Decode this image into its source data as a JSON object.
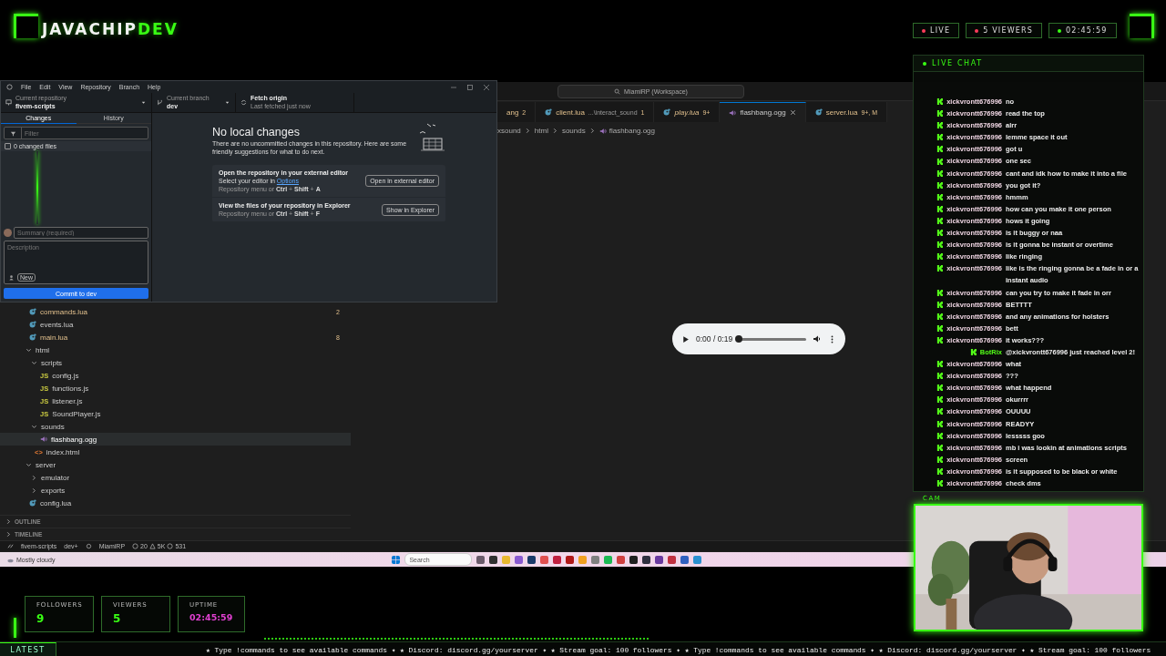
{
  "overlay": {
    "brand": {
      "name": "JAVACHIP",
      "accent": "DEV"
    },
    "badges": [
      {
        "label": "LIVE",
        "color": "#ff3b5c"
      },
      {
        "label": "5 VIEWERS",
        "color": "#ff3b5c"
      },
      {
        "label": "02:45:59",
        "color": "#39ff14"
      }
    ]
  },
  "github_desktop": {
    "menu": [
      "File",
      "Edit",
      "View",
      "Repository",
      "Branch",
      "Help"
    ],
    "repository": {
      "caption": "Current repository",
      "value": "fivem-scripts"
    },
    "branch": {
      "caption": "Current branch",
      "value": "dev"
    },
    "fetch": {
      "caption": "Fetch origin",
      "detail": "Last fetched just now"
    },
    "tabs": [
      {
        "label": "Changes",
        "selected": true
      },
      {
        "label": "History",
        "selected": false
      }
    ],
    "filter": {
      "placeholder": "Filter"
    },
    "select_all": {
      "checked": false,
      "label": "0 changed files"
    },
    "summary": {
      "placeholder": "Summary (required)"
    },
    "description": {
      "placeholder": "Description"
    },
    "coauthor_badge": "New",
    "commit_button": "Commit to dev",
    "heading": "No local changes",
    "intro": "There are no uncommitted changes in this repository. Here are some friendly suggestions for what to do next.",
    "suggestions": [
      {
        "title": "Open the repository in your external editor",
        "line": "Select your editor in",
        "link": "Options",
        "hint": "Repository menu or **Ctrl** + **Shift** + **A**",
        "button": "Open in external editor"
      },
      {
        "title": "View the files of your repository in Explorer",
        "hint": "Repository menu or **Ctrl** + **Shift** + **F**",
        "button": "Show in Explorer"
      }
    ]
  },
  "vscode": {
    "search": "MiamiRP (Workspace)",
    "tabs": [
      {
        "label": "ang",
        "badge": "2",
        "modified": true,
        "preview": false,
        "selected": false
      },
      {
        "label": "client.lua",
        "detail": "...\\interact_sound",
        "badge": "1",
        "kind": "lua",
        "modified": true,
        "preview": false,
        "selected": false
      },
      {
        "label": "play.lua",
        "badge": "9+",
        "kind": "lua",
        "modified": true,
        "preview": true,
        "selected": false
      },
      {
        "label": "flashbang.ogg",
        "kind": "audio",
        "modified": false,
        "preview": false,
        "selected": true
      },
      {
        "label": "server.lua",
        "badge": "9+, M",
        "kind": "lua",
        "modified": true,
        "preview": false,
        "selected": false
      }
    ],
    "breadcrumb": [
      "xsound",
      "html",
      "sounds",
      "flashbang.ogg"
    ],
    "explorer": [
      {
        "name": "commands.lua",
        "kind": "lua",
        "modified": true,
        "badge": "2",
        "selected": false
      },
      {
        "name": "events.lua",
        "kind": "lua",
        "modified": false,
        "selected": false
      },
      {
        "name": "main.lua",
        "kind": "lua",
        "modified": true,
        "badge": "8",
        "selected": false
      },
      {
        "name": "html",
        "kind": "folder",
        "expanded": true,
        "selected": false,
        "children": [
          {
            "name": "scripts",
            "kind": "folder",
            "expanded": true,
            "selected": false,
            "children": [
              {
                "name": "config.js",
                "kind": "js",
                "icon_text": "JS",
                "modified": false,
                "selected": false
              },
              {
                "name": "functions.js",
                "kind": "js",
                "icon_text": "JS",
                "modified": false,
                "selected": false
              },
              {
                "name": "listener.js",
                "kind": "js",
                "icon_text": "JS",
                "modified": false,
                "selected": false
              },
              {
                "name": "SoundPlayer.js",
                "kind": "js",
                "icon_text": "JS",
                "modified": false,
                "selected": false
              }
            ]
          },
          {
            "name": "sounds",
            "kind": "folder",
            "expanded": true,
            "selected": false,
            "children": [
              {
                "name": "flashbang.ogg",
                "kind": "audio",
                "modified": false,
                "selected": true
              }
            ]
          },
          {
            "name": "index.html",
            "kind": "html",
            "icon_text": "<>",
            "modified": false,
            "selected": false
          }
        ]
      },
      {
        "name": "server",
        "kind": "folder",
        "expanded": true,
        "selected": false,
        "children": [
          {
            "name": "emulator",
            "kind": "folder",
            "expanded": false,
            "selected": false
          },
          {
            "name": "exports",
            "kind": "folder",
            "expanded": false,
            "selected": false
          }
        ]
      },
      {
        "name": "config.lua",
        "kind": "lua",
        "modified": false,
        "selected": false
      }
    ],
    "sections": [
      {
        "label": "OUTLINE",
        "expanded": false
      },
      {
        "label": "TIMELINE",
        "expanded": false
      }
    ],
    "audio": {
      "time": "0:00 / 0:19",
      "level": 0
    },
    "status_bar": {
      "workspace": "fivem-scripts",
      "branch": "dev+",
      "project": "MiamiRP",
      "errors": "20",
      "warnings": "5K",
      "infos": "531"
    }
  },
  "taskbar": {
    "weather": "Mostly cloudy",
    "search_placeholder": "Search",
    "apps": [
      {
        "color": "#6a5a6a"
      },
      {
        "color": "#303030"
      },
      {
        "color": "#e8b830"
      },
      {
        "color": "#8a5ad0"
      },
      {
        "color": "#1a3a6a"
      },
      {
        "color": "#e05050"
      },
      {
        "color": "#c02040"
      },
      {
        "color": "#b01818"
      },
      {
        "color": "#f0a020"
      },
      {
        "color": "#808080"
      },
      {
        "color": "#1db954"
      },
      {
        "color": "#d04040"
      },
      {
        "color": "#202020"
      },
      {
        "color": "#303040"
      },
      {
        "color": "#6a3aa0"
      },
      {
        "color": "#c03040"
      },
      {
        "color": "#3060c0"
      },
      {
        "color": "#2a90d0"
      }
    ]
  },
  "chat": {
    "title": "LIVE CHAT",
    "messages": [
      {
        "kind": "viewer",
        "user": "xickvrontt676996",
        "text": "no"
      },
      {
        "kind": "viewer",
        "user": "xickvrontt676996",
        "text": "read the top"
      },
      {
        "kind": "viewer",
        "user": "xickvrontt676996",
        "text": "alrr"
      },
      {
        "kind": "viewer",
        "user": "xickvrontt676996",
        "text": "lemme space it out"
      },
      {
        "kind": "viewer",
        "user": "xickvrontt676996",
        "text": "got u"
      },
      {
        "kind": "viewer",
        "user": "xickvrontt676996",
        "text": "one sec"
      },
      {
        "kind": "viewer",
        "user": "xickvrontt676996",
        "text": "cant and idk how to make it into a file"
      },
      {
        "kind": "viewer",
        "user": "xickvrontt676996",
        "text": "you got it?"
      },
      {
        "kind": "viewer",
        "user": "xickvrontt676996",
        "text": "hmmm"
      },
      {
        "kind": "viewer",
        "user": "xickvrontt676996",
        "text": "how can you make it one person"
      },
      {
        "kind": "viewer",
        "user": "xickvrontt676996",
        "text": "hows it going"
      },
      {
        "kind": "viewer",
        "user": "xickvrontt676996",
        "text": "is it buggy or naa"
      },
      {
        "kind": "viewer",
        "user": "xickvrontt676996",
        "text": "is it gonna be instant or overtime"
      },
      {
        "kind": "viewer",
        "user": "xickvrontt676996",
        "text": "like ringing"
      },
      {
        "kind": "viewer",
        "user": "xickvrontt676996",
        "text": "like is the ringing gonna be a fade in or a instant audio"
      },
      {
        "kind": "viewer",
        "user": "xickvrontt676996",
        "text": "can you try to make it fade in orr"
      },
      {
        "kind": "viewer",
        "user": "xickvrontt676996",
        "text": "BETTTT"
      },
      {
        "kind": "viewer",
        "user": "xickvrontt676996",
        "text": "and any animations for holsters"
      },
      {
        "kind": "viewer",
        "user": "xickvrontt676996",
        "text": "bett"
      },
      {
        "kind": "viewer",
        "user": "xickvrontt676996",
        "text": "it works???"
      },
      {
        "kind": "bot",
        "user": "BotRix",
        "text": "@xickvrontt676996 just reached level 2!"
      },
      {
        "kind": "viewer",
        "user": "xickvrontt676996",
        "text": "what"
      },
      {
        "kind": "viewer",
        "user": "xickvrontt676996",
        "text": "???"
      },
      {
        "kind": "viewer",
        "user": "xickvrontt676996",
        "text": "what happend"
      },
      {
        "kind": "viewer",
        "user": "xickvrontt676996",
        "text": "okurrrr"
      },
      {
        "kind": "viewer",
        "user": "xickvrontt676996",
        "text": "OUUUU"
      },
      {
        "kind": "viewer",
        "user": "xickvrontt676996",
        "text": "READYY"
      },
      {
        "kind": "viewer",
        "user": "xickvrontt676996",
        "text": "lesssss goo"
      },
      {
        "kind": "viewer",
        "user": "xickvrontt676996",
        "text": "mb i was lookin at animations scripts"
      },
      {
        "kind": "viewer",
        "user": "xickvrontt676996",
        "text": "screen"
      },
      {
        "kind": "viewer",
        "user": "xickvrontt676996",
        "text": "is it supposed to be black or white"
      },
      {
        "kind": "viewer",
        "user": "xickvrontt676996",
        "text": "check dms"
      }
    ]
  },
  "cam": {
    "label": "CAM",
    "kind": "picture"
  },
  "stats": [
    {
      "label": "FOLLOWERS",
      "value": "9",
      "kind": "count"
    },
    {
      "label": "VIEWERS",
      "value": "5",
      "kind": "count"
    },
    {
      "label": "UPTIME",
      "value": "02:45:59",
      "kind": "time"
    }
  ],
  "ticker": {
    "label": "LATEST",
    "text": "★ Type !commands to see available commands ✦ ★ Discord: discord.gg/yourserver ✦ ★ Stream goal: 100 followers ✦ ★ Type !commands to see available commands ✦ ★ Discord: discord.gg/yourserver ✦ ★ Stream goal: 100 followers"
  }
}
